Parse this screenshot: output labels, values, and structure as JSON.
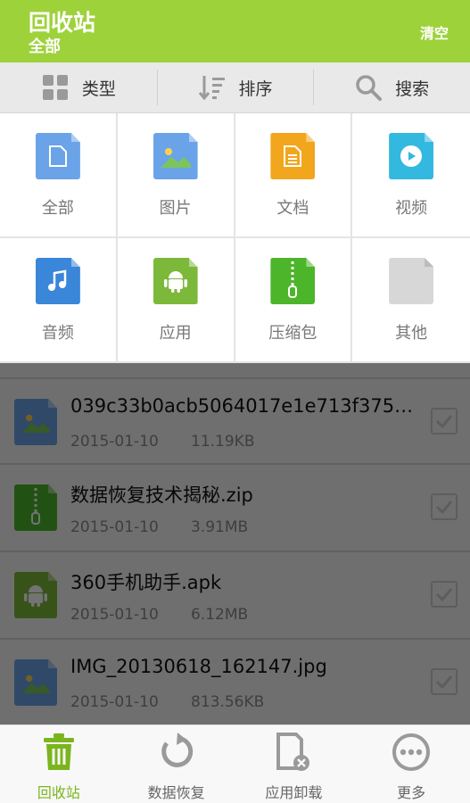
{
  "header": {
    "title": "回收站",
    "subtitle": "全部",
    "clear_label": "清空"
  },
  "toolbar": {
    "items": [
      {
        "label": "类型",
        "icon": "grid-icon"
      },
      {
        "label": "排序",
        "icon": "sort-icon"
      },
      {
        "label": "搜索",
        "icon": "search-icon"
      }
    ]
  },
  "categories": [
    {
      "label": "全部",
      "icon": "all-file-icon",
      "color": "#6aa3e8"
    },
    {
      "label": "图片",
      "icon": "image-file-icon",
      "color": "#6aa3e8"
    },
    {
      "label": "文档",
      "icon": "document-file-icon",
      "color": "#f2a61d"
    },
    {
      "label": "视频",
      "icon": "video-file-icon",
      "color": "#33b8e0"
    },
    {
      "label": "音频",
      "icon": "audio-file-icon",
      "color": "#3a86d8"
    },
    {
      "label": "应用",
      "icon": "android-file-icon",
      "color": "#7cb83a"
    },
    {
      "label": "压缩包",
      "icon": "zip-file-icon",
      "color": "#4db52a"
    },
    {
      "label": "其他",
      "icon": "other-file-icon",
      "color": "#d7d7d7"
    }
  ],
  "files": [
    {
      "name": "039c33b0acb5064017e1e713f375e...",
      "date": "2015-01-10",
      "size": "11.19KB",
      "icon": "image-file-icon"
    },
    {
      "name": "数据恢复技术揭秘.zip",
      "date": "2015-01-10",
      "size": "3.91MB",
      "icon": "zip-file-icon"
    },
    {
      "name": "360手机助手.apk",
      "date": "2015-01-10",
      "size": "6.12MB",
      "icon": "android-file-icon"
    },
    {
      "name": "IMG_20130618_162147.jpg",
      "date": "2015-01-10",
      "size": "813.56KB",
      "icon": "image-file-icon"
    }
  ],
  "bottom_nav": {
    "items": [
      {
        "label": "回收站",
        "icon": "trash-icon",
        "active": true
      },
      {
        "label": "数据恢复",
        "icon": "restore-icon",
        "active": false
      },
      {
        "label": "应用卸载",
        "icon": "uninstall-icon",
        "active": false
      },
      {
        "label": "更多",
        "icon": "more-icon",
        "active": false
      }
    ]
  },
  "colors": {
    "accent": "#9ed23b",
    "active_nav": "#7ab51d"
  }
}
